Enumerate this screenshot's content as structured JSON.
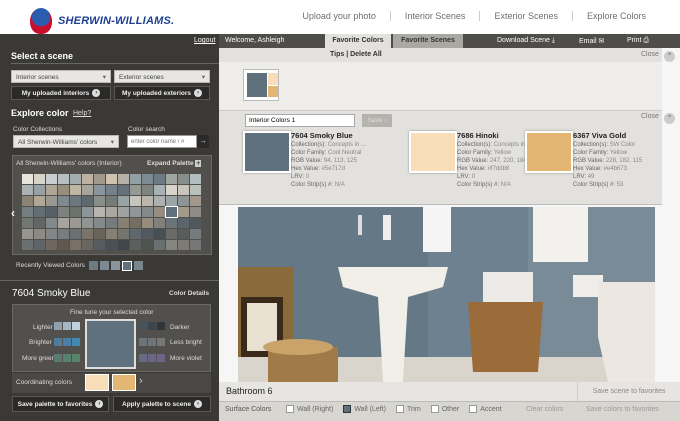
{
  "brand": {
    "logo_text": "SHERWIN-WILLIAMS."
  },
  "topnav": [
    "Upload your photo",
    "Interior Scenes",
    "Exterior Scenes",
    "Explore Colors"
  ],
  "left": {
    "select_scene": "Select a scene",
    "logout": "Logout",
    "interior_select": "Interior scenes",
    "exterior_select": "Exterior scenes",
    "my_interiors": "My uploaded interiors",
    "my_exteriors": "My uploaded exteriors",
    "explore_color": "Explore color",
    "help": "Help?",
    "collections_label": "Color Collections",
    "collections_value": "All Sherwin-Williams' colors",
    "search_label": "Color search",
    "search_placeholder": "enter color name / #",
    "palette_title": "All Sherwin-Williams' colors (Interior)",
    "expand_palette": "Expand Palette",
    "recently_viewed": "Recently Viewed Colors",
    "selected_color": "7604 Smoky Blue",
    "color_details": "Color Details",
    "fine_tune": "Fine tune your selected color",
    "lighter": "Lighter",
    "darker": "Darker",
    "brighter": "Brighter",
    "less_bright": "Less bright",
    "more_green": "More green",
    "more_violet": "More violet",
    "coordinating": "Coordinating colors",
    "save_palette": "Save palette to favorites",
    "apply_palette": "Apply palette to scene"
  },
  "right": {
    "welcome": "Welcome, Ashleigh",
    "tab_fav_colors": "Favorite Colors",
    "tab_fav_scenes": "Favorite Scenes",
    "download": "Download Scene",
    "email": "Email",
    "print": "Print",
    "tips": "Tips | Delete All",
    "close": "Close",
    "palette_name": "Interior Colors 1",
    "save_btn": "Save",
    "colors": [
      {
        "name": "7604 Smoky Blue",
        "hex_color": "#5e717d",
        "collection": "Concepts in ...",
        "family": "Cool Neutral",
        "rgb": "94, 113, 125",
        "hex": "#5e717d",
        "lrv": "0",
        "strip": "N/A"
      },
      {
        "name": "7686 Hinoki",
        "hex_color": "#f7ddb8",
        "collection": "Concepts in ...",
        "family": "Yellow",
        "rgb": "247, 220, 184",
        "hex": "#f7ddb8",
        "lrv": "0",
        "strip": "N/A"
      },
      {
        "name": "6367 Viva Gold",
        "hex_color": "#e4b673",
        "collection": "SW Color",
        "family": "Yellow",
        "rgb": "228, 182, 115",
        "hex": "#e4b673",
        "lrv": "49",
        "strip": "53"
      }
    ],
    "labels": {
      "collection": "Collection(s):",
      "family": "Color Family:",
      "rgb": "RGB Value:",
      "hex": "Hex Value:",
      "lrv": "LRV:",
      "strip": "Color Strip(s) #:"
    },
    "scene_name": "Bathroom 6",
    "save_scene": "Save scene to favorites",
    "surface_colors": "Surface Colors",
    "surfaces": [
      "Wall (Right)",
      "Wall (Left)",
      "Trim",
      "Other",
      "Accent"
    ],
    "clear_colors": "Clear colors",
    "save_colors": "Save colors to favorites"
  }
}
